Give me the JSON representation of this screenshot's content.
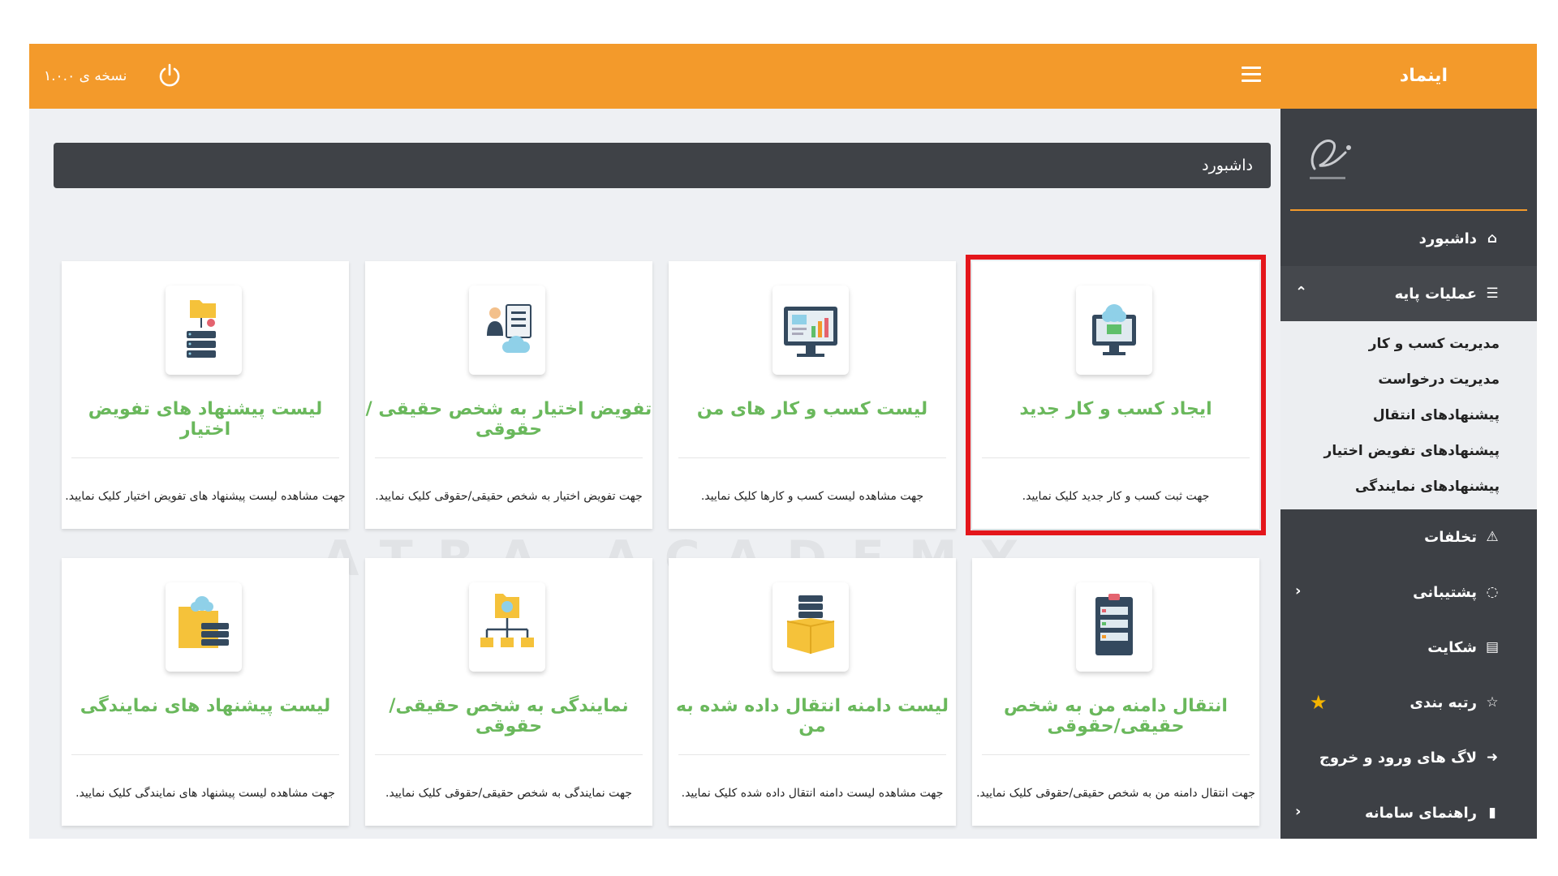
{
  "header": {
    "brand": "اینماد",
    "version": "نسخه ی ۱.۰.۰",
    "menu_icon": "hamburger-icon",
    "power_icon": "power-icon"
  },
  "sidebar": {
    "items": [
      {
        "label": "داشبورد",
        "icon": "home-icon"
      },
      {
        "label": "عملیات پایه",
        "icon": "list-icon"
      },
      {
        "label": "تخلفات",
        "icon": "warning-icon"
      },
      {
        "label": "پشتیبانی",
        "icon": "chat-icon"
      },
      {
        "label": "شکایت",
        "icon": "document-icon"
      },
      {
        "label": "رتبه بندی",
        "icon": "star-icon"
      },
      {
        "label": "لاگ های ورود و خروج",
        "icon": "arrow-circle-icon"
      },
      {
        "label": "راهنمای سامانه",
        "icon": "file-icon"
      }
    ],
    "submenu": [
      "مدیریت کسب و کار",
      "مدیریت درخواست",
      "پیشنهادهای انتقال",
      "پیشنهادهای تفویض اختیار",
      "پیشنهادهای نمایندگی"
    ]
  },
  "page": {
    "title": "داشبورد",
    "watermark": "ATRA ACADEMY"
  },
  "cards": [
    {
      "title": "ایجاد کسب و کار جدید",
      "desc": "جهت ثبت کسب و کار جدید کلیک نمایید.",
      "icon": "monitor-cloud-icon",
      "selected": true
    },
    {
      "title": "لیست کسب و کار های من",
      "desc": "جهت مشاهده لیست کسب و کارها کلیک نمایید.",
      "icon": "monitor-chart-icon"
    },
    {
      "title": "تفویض اختیار به شخص حقیقی / حقوقی",
      "desc": "جهت تفویض اختیار به شخص حقیقی/حقوقی کلیک نمایید.",
      "icon": "person-cloud-icon"
    },
    {
      "title": "لیست پیشنهاد های تفویض اختیار",
      "desc": "جهت مشاهده لیست پیشنهاد های تفویض اختیار کلیک نمایید.",
      "icon": "folder-server-icon"
    },
    {
      "title": "انتقال دامنه من به شخص حقیقی/حقوقی",
      "desc": "جهت انتقال دامنه من به شخص حقیقی/حقوقی کلیک نمایید.",
      "icon": "clipboard-icon"
    },
    {
      "title": "لیست دامنه انتقال داده شده به من",
      "desc": "جهت مشاهده لیست دامنه انتقال داده شده کلیک نمایید.",
      "icon": "box-server-icon"
    },
    {
      "title": "نمایندگی به شخص حقیقی/حقوقی",
      "desc": "جهت نمایندگی به شخص حقیقی/حقوقی کلیک نمایید.",
      "icon": "network-folder-icon"
    },
    {
      "title": "لیست پیشنهاد های نمایندگی",
      "desc": "جهت مشاهده لیست پیشنهاد های نمایندگی کلیک نمایید.",
      "icon": "folder-cloud-server-icon"
    }
  ],
  "colors": {
    "topbar": "#f39a2b",
    "sidebar": "#3d4045",
    "card_title": "#6ab85c",
    "selection": "#e4161b",
    "rating_star": "#f5b400"
  }
}
